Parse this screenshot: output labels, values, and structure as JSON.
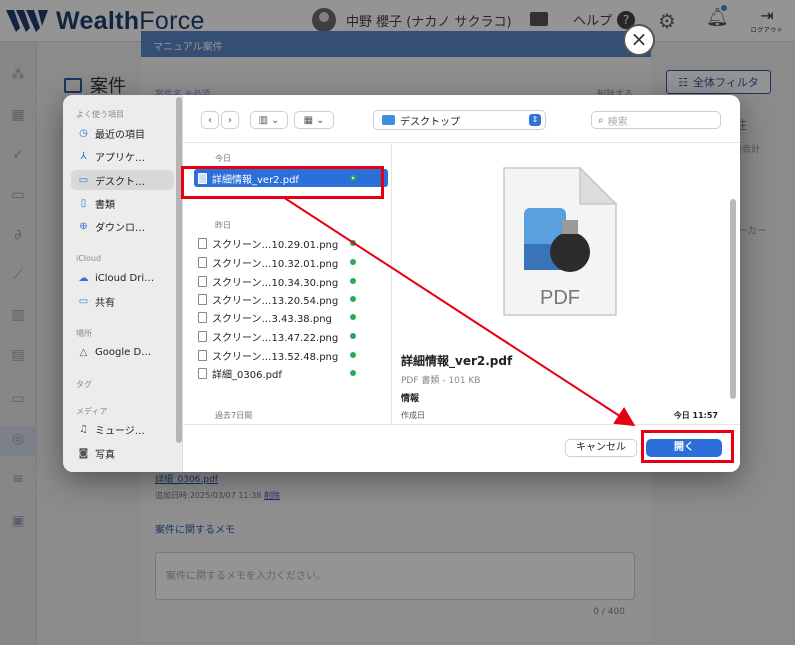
{
  "app": {
    "logo_text_left": "Wealth",
    "logo_text_right": "Force",
    "user_name": "中野 櫻子 (ナカノ サクラコ)",
    "help_label": "ヘルプ",
    "help_icon": "?",
    "logout_label": "ログアウト",
    "page_title": "案件",
    "filter_button": "全体フィルタ",
    "right_fragment_1": "注",
    "right_fragment_2": "益合計",
    "right_fragment_3": "ーカー"
  },
  "case_modal": {
    "title": "マニュアル案件",
    "row_label": "案件名 ※必須",
    "row_right": "削除する",
    "attachment_file": "詳細_0306.pdf",
    "attachment_meta": "追加日時:2025/03/07 11:38",
    "attachment_delete": "削除",
    "memo_label": "案件に関するメモ",
    "memo_placeholder": "案件に関するメモを入力ください。",
    "memo_count": "0 / 400",
    "close_icon": "×"
  },
  "dialog": {
    "sidebar": {
      "sections": {
        "favorites": "よく使う項目",
        "icloud": "iCloud",
        "locations": "場所",
        "tags": "タグ",
        "media": "メディア"
      },
      "items": {
        "recent": "最近の項目",
        "apps": "アプリケ…",
        "desktop": "デスクト…",
        "documents": "書類",
        "downloads": "ダウンロ…",
        "icloud_drive": "iCloud Dri…",
        "shared": "共有",
        "google_drive": "Google D…",
        "music": "ミュージ…",
        "photos": "写真"
      }
    },
    "toolbar": {
      "back": "‹",
      "forward": "›",
      "location": "デスクトップ",
      "search_placeholder": "検索"
    },
    "list": {
      "group_today": "今日",
      "group_yesterday": "昨日",
      "group_past7": "過去7日間",
      "selected_file": "詳細情報_ver2.pdf",
      "files_yesterday": [
        "スクリーン…10.29.01.png",
        "スクリーン…10.32.01.png",
        "スクリーン…10.34.30.png",
        "スクリーン…13.20.54.png",
        "スクリーン…3.43.38.png",
        "スクリーン…13.47.22.png",
        "スクリーン…13.52.48.png",
        "詳細_0306.pdf"
      ]
    },
    "preview": {
      "icon_label": "PDF",
      "name": "詳細情報_ver2.pdf",
      "kind": "PDF 書類 - 101 KB",
      "info_heading": "情報",
      "created_label": "作成日",
      "created_value": "今日 11:57"
    },
    "footer": {
      "cancel": "キャンセル",
      "open": "開く"
    }
  },
  "colors": {
    "highlight": "#e60012",
    "primary_blue": "#2c6fd9",
    "brand": "#1f3e70"
  }
}
